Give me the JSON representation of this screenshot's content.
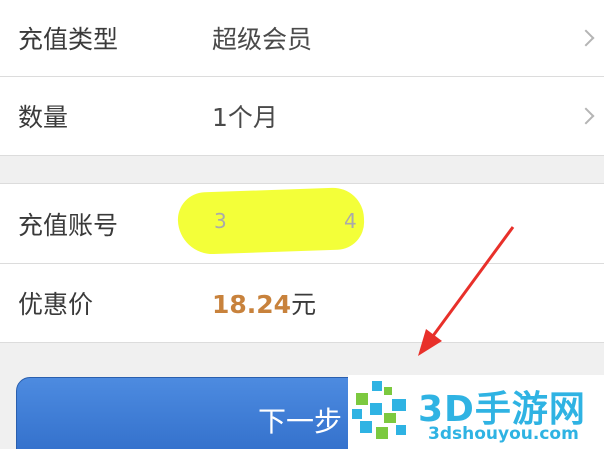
{
  "form": {
    "recharge_type_label": "充值类型",
    "recharge_type_value": "超级会员",
    "quantity_label": "数量",
    "quantity_value": "1个月",
    "account_label": "充值账号",
    "account_value_start": "3",
    "account_value_end": "4",
    "price_label": "优惠价",
    "price_amount": "18.24",
    "price_unit": "元"
  },
  "next_button": {
    "label": "下一步"
  },
  "watermark": {
    "title": "3D手游网",
    "url": "3dshouyou.com"
  },
  "colors": {
    "highlight": "#f2ff2e",
    "price": "#c8823c",
    "button": "#3a78d4",
    "arrow": "#e8302a",
    "watermark": "#2fb3e3"
  }
}
